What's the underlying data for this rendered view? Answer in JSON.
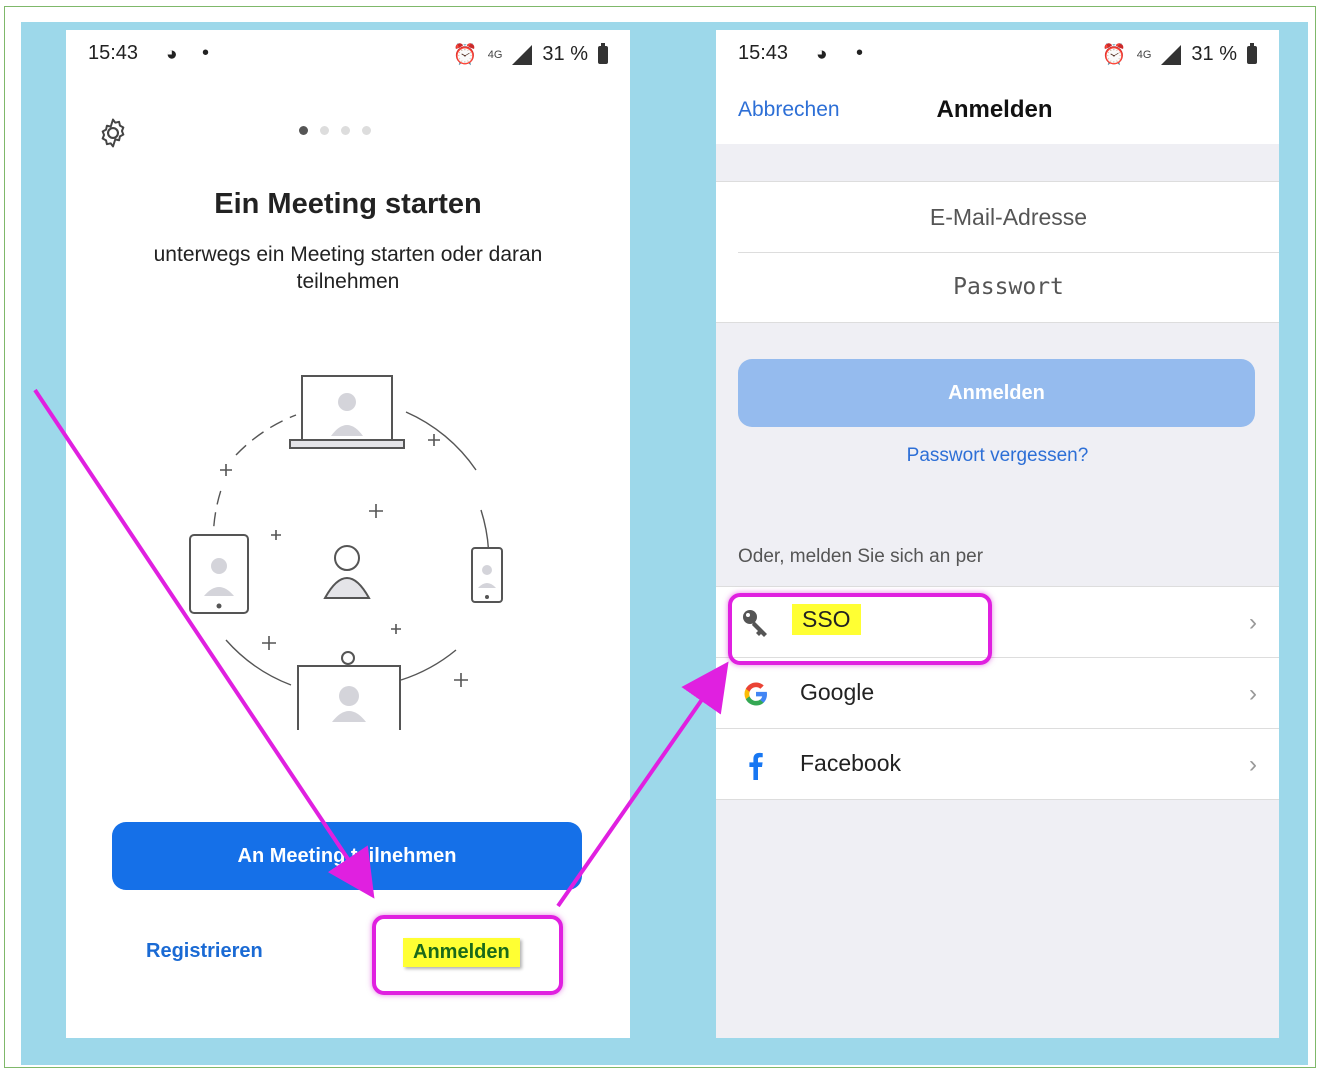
{
  "left_screen": {
    "status": {
      "time": "15:43",
      "net": "4G",
      "battery": "31 %"
    },
    "pager_dots": 4,
    "title": "Ein Meeting starten",
    "subtitle": "unterwegs ein Meeting starten oder daran teilnehmen",
    "join_button": "An Meeting teilnehmen",
    "register_link": "Registrieren",
    "login_link": "Anmelden"
  },
  "right_screen": {
    "status": {
      "time": "15:43",
      "net": "4G",
      "battery": "31 %"
    },
    "cancel": "Abbrechen",
    "title": "Anmelden",
    "email_placeholder": "E-Mail-Adresse",
    "password_placeholder": "Passwort",
    "login_button": "Anmelden",
    "forgot_password": "Passwort vergessen?",
    "or_label": "Oder, melden Sie sich an per",
    "providers": [
      {
        "label": "SSO",
        "icon": "key-icon"
      },
      {
        "label": "Google",
        "icon": "google-icon"
      },
      {
        "label": "Facebook",
        "icon": "facebook-icon"
      }
    ]
  },
  "colors": {
    "background": "#9dd8ea",
    "primary_blue": "#1570e8",
    "disabled_blue": "#95bbee",
    "link_blue": "#2d6fd6",
    "annotation_magenta": "#e020e0",
    "highlight_yellow": "#ffff33"
  }
}
